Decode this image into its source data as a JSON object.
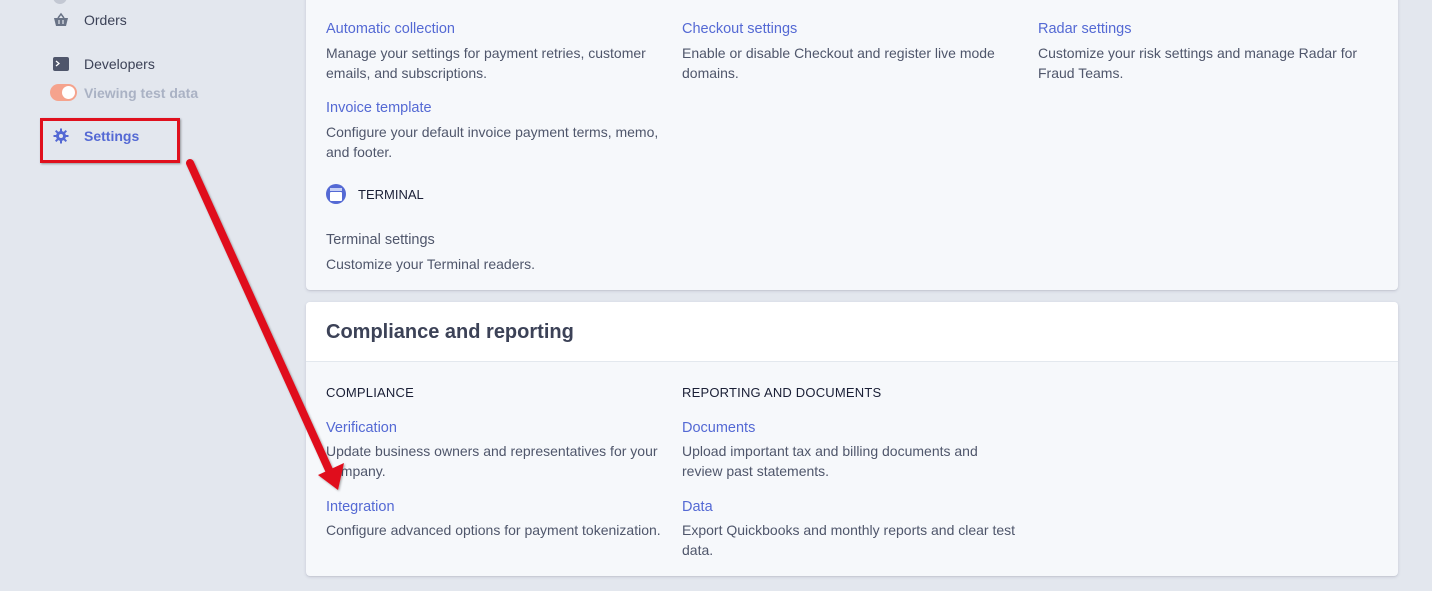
{
  "sidebar": {
    "items": [
      {
        "label": "Orders",
        "icon": "basket-icon"
      },
      {
        "label": "Developers",
        "icon": "terminal-icon"
      },
      {
        "label": "Settings",
        "icon": "gear-icon"
      }
    ],
    "test_mode": {
      "label": "Viewing test data",
      "enabled": true
    }
  },
  "billing_section": {
    "items": [
      {
        "title": "Automatic collection",
        "description": "Manage your settings for payment retries, customer emails, and subscriptions."
      },
      {
        "title": "Invoice template",
        "description": "Configure your default invoice payment terms, memo, and footer."
      }
    ]
  },
  "checkout_section": {
    "items": [
      {
        "title": "Checkout settings",
        "description": "Enable or disable Checkout and register live mode domains."
      }
    ]
  },
  "radar_section": {
    "items": [
      {
        "title": "Radar settings",
        "description": "Customize your risk settings and manage Radar for Fraud Teams."
      }
    ]
  },
  "terminal_section": {
    "label": "TERMINAL",
    "items": [
      {
        "title": "Terminal settings",
        "description": "Customize your Terminal readers."
      }
    ]
  },
  "compliance_card": {
    "title": "Compliance and reporting",
    "compliance": {
      "label": "COMPLIANCE",
      "items": [
        {
          "title": "Verification",
          "description": "Update business owners and representatives for your company."
        },
        {
          "title": "Integration",
          "description": "Configure advanced options for payment tokenization."
        }
      ]
    },
    "reporting": {
      "label": "REPORTING AND DOCUMENTS",
      "items": [
        {
          "title": "Documents",
          "description": "Upload important tax and billing documents and review past statements."
        },
        {
          "title": "Data",
          "description": "Export Quickbooks and monthly reports and clear test data."
        }
      ]
    }
  },
  "colors": {
    "accent": "#5469d4",
    "annotation": "#e0101d",
    "background": "#e3e7ee",
    "card": "#f6f8fb"
  }
}
